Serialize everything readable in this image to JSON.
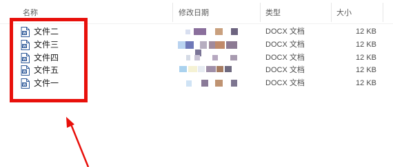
{
  "columns": {
    "name": "名称",
    "modified": "修改日期",
    "type": "类型",
    "size": "大小"
  },
  "files": [
    {
      "name": "文件二",
      "type": "DOCX 文档",
      "size": "12 KB"
    },
    {
      "name": "文件三",
      "type": "DOCX 文档",
      "size": "12 KB"
    },
    {
      "name": "文件四",
      "type": "DOCX 文档",
      "size": "12 KB"
    },
    {
      "name": "文件五",
      "type": "DOCX 文档",
      "size": "12 KB"
    },
    {
      "name": "文件一",
      "type": "DOCX 文档",
      "size": "12 KB"
    }
  ],
  "colors": {
    "annotation": "#e8100b",
    "word_icon": "#2b5797"
  },
  "icons": {
    "file": "word-document-icon"
  }
}
